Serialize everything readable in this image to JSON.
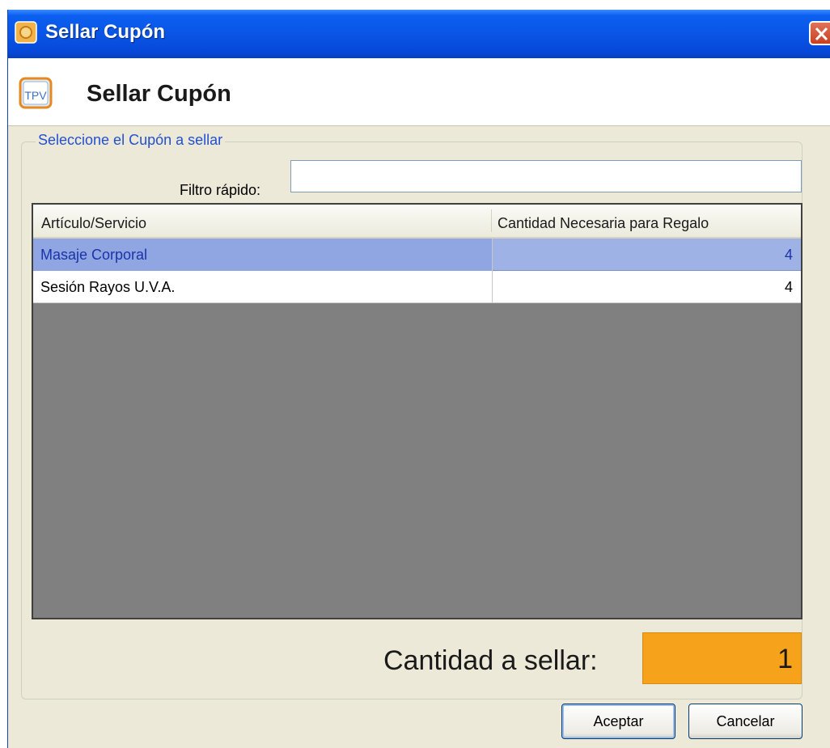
{
  "window": {
    "title": "Sellar Cupón"
  },
  "header": {
    "title": "Sellar Cupón",
    "icon_text": "TPV"
  },
  "group": {
    "legend": "Seleccione el Cupón a sellar"
  },
  "filter": {
    "label": "Filtro rápido:",
    "value": ""
  },
  "grid": {
    "columns": [
      "Artículo/Servicio",
      "Cantidad Necesaria para Regalo"
    ],
    "rows": [
      {
        "item": "Masaje Corporal",
        "qty": "4",
        "selected": true
      },
      {
        "item": "Sesión Rayos U.V.A.",
        "qty": "4",
        "selected": false
      }
    ]
  },
  "quantity": {
    "label": "Cantidad a sellar:",
    "value": "1",
    "color": "#f7a21b"
  },
  "buttons": {
    "accept": "Aceptar",
    "cancel": "Cancelar"
  },
  "colors": {
    "titlebar": "#0a55e6",
    "selection": "#9eb2e6",
    "legend_text": "#2250d0"
  }
}
